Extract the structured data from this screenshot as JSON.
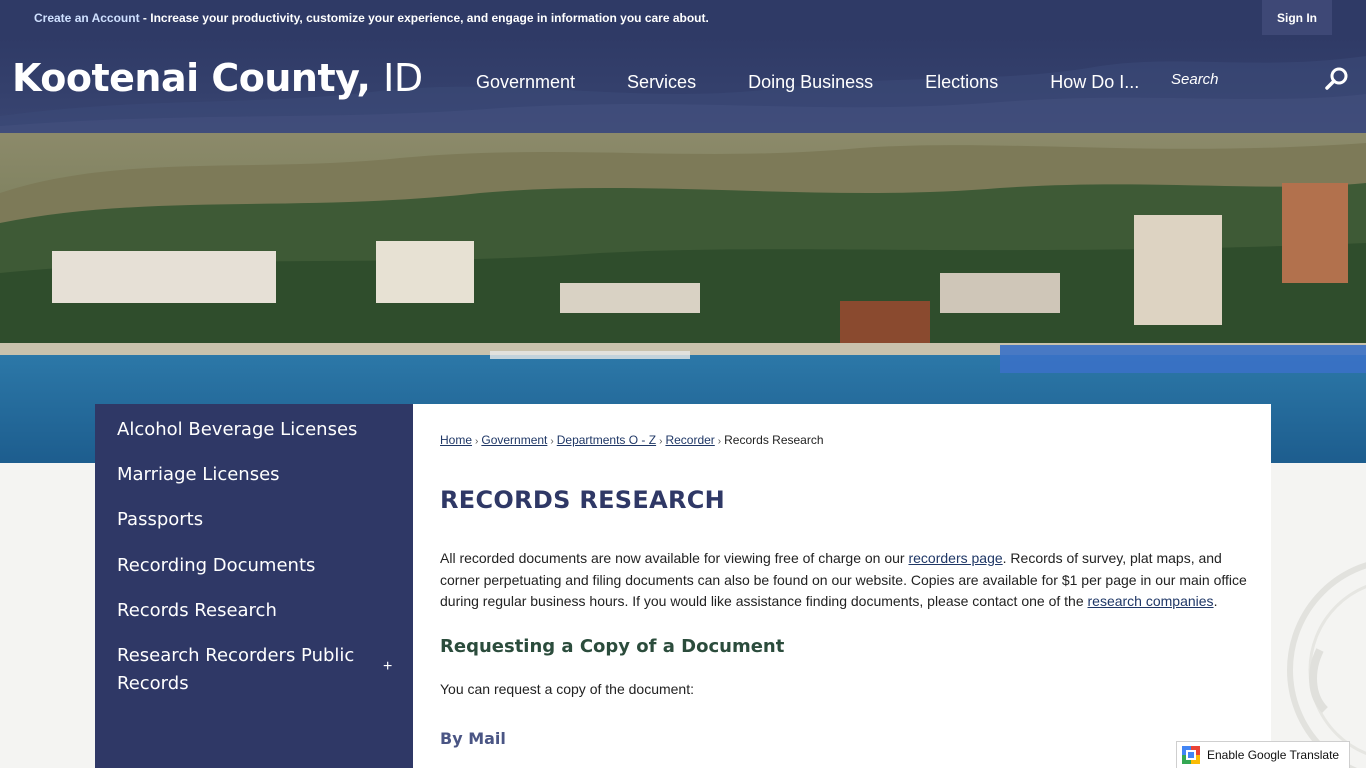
{
  "topbar": {
    "create_account_link": "Create an Account",
    "message": " - Increase your productivity, customize your experience, and engage in information you care about.",
    "sign_in": "Sign In"
  },
  "header": {
    "brand_name": "Kootenai County,",
    "brand_state": "ID",
    "nav": [
      "Government",
      "Services",
      "Doing Business",
      "Elections",
      "How Do I..."
    ],
    "search_placeholder": "Search"
  },
  "sidebar": {
    "items": [
      "Alcohol Beverage Licenses",
      "Marriage Licenses",
      "Passports",
      "Recording Documents",
      "Records Research",
      "Research Recorders Public Records"
    ],
    "expand_symbol": "+"
  },
  "breadcrumb": {
    "items": [
      "Home",
      "Government",
      "Departments O - Z",
      "Recorder"
    ],
    "current": "Records Research",
    "separator": "›"
  },
  "content": {
    "title": "RECORDS RESEARCH",
    "p1_a": "All recorded documents are now available for viewing free of charge on our ",
    "p1_link1": "recorders page",
    "p1_b": ". Records of survey, plat maps, and corner perpetuating and filing documents can also be found on our website. Copies are available for $1 per page in our main office during regular business hours. If you would like assistance finding documents, please contact one of the ",
    "p1_link2": "research companies",
    "p1_c": ".",
    "section_heading": "Requesting a Copy of a Document",
    "p2": "You can request a copy of the document:",
    "subheading": "By Mail"
  },
  "translate": {
    "label": "Enable Google Translate"
  },
  "colors": {
    "navy": "#2f3866",
    "topbar": "#2f3a66",
    "heading_green": "#2b4c3c",
    "link": "#1f3766"
  },
  "icons": {
    "search": "search-icon",
    "translate": "google-translate-icon"
  }
}
